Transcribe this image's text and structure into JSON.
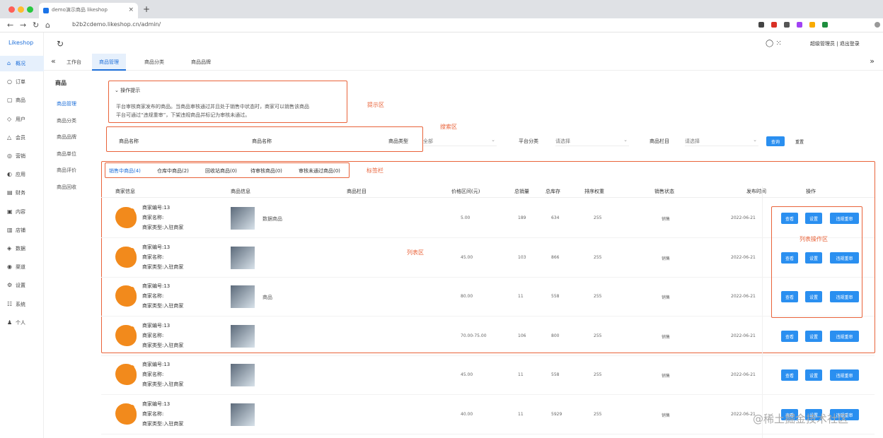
{
  "browser": {
    "tab_title": "demo演示商品 likeshop",
    "tab_close": "×",
    "new_tab": "+",
    "url": "b2b2cdemo.likeshop.cn/admin/",
    "nav": [
      "←",
      "→",
      "↻",
      "⌂"
    ]
  },
  "app": {
    "logo": "Likeshop",
    "refresh": "↻",
    "top_icons": "◯ ⁙",
    "user": "超级管理员 | 退出登录"
  },
  "sidebar": {
    "items": [
      {
        "icon": "⌂",
        "label": "概况",
        "active": true
      },
      {
        "icon": "○",
        "label": "订单"
      },
      {
        "icon": "▢",
        "label": "商品"
      },
      {
        "icon": "◇",
        "label": "用户"
      },
      {
        "icon": "△",
        "label": "会员"
      },
      {
        "icon": "◎",
        "label": "营销"
      },
      {
        "icon": "◐",
        "label": "应用"
      },
      {
        "icon": "▤",
        "label": "财务"
      },
      {
        "icon": "▣",
        "label": "内容"
      },
      {
        "icon": "▥",
        "label": "店铺"
      },
      {
        "icon": "◈",
        "label": "数据"
      },
      {
        "icon": "◉",
        "label": "渠道"
      },
      {
        "icon": "⚙",
        "label": "设置"
      },
      {
        "icon": "☷",
        "label": "系统"
      },
      {
        "icon": "♟",
        "label": "个人"
      }
    ]
  },
  "submenu": {
    "title": "商品",
    "items": [
      {
        "label": "商品管理",
        "active": true
      },
      {
        "label": "商品分类"
      },
      {
        "label": "商品品牌"
      },
      {
        "label": "商品单位"
      },
      {
        "label": "商品评价"
      },
      {
        "label": "商品回收"
      }
    ]
  },
  "page_tabs": {
    "collapse": "«",
    "expand": "»",
    "items": [
      {
        "label": "工作台"
      },
      {
        "label": "商品管理",
        "active": true
      },
      {
        "label": "商品分类"
      },
      {
        "label": "商品品牌"
      }
    ]
  },
  "tip": {
    "title": "操作提示",
    "lines": [
      "平台审核商家发布的商品。当商品审核通过并且处于销售中状态时，商家可以销售该商品",
      "平台可通过“违规重审”，下架违规商品并标记为审核未通过。"
    ],
    "annotation": "提示区"
  },
  "filter": {
    "annotation": "搜索区",
    "fields": [
      {
        "label": "商品名称"
      },
      {
        "label": "商品名称"
      },
      {
        "label": "商品类型",
        "value": "全部"
      },
      {
        "label": "平台分类",
        "value": "请选择"
      },
      {
        "label": "商品栏目",
        "value": "请选择"
      }
    ],
    "query_button": "查询",
    "reset_button": "重置",
    "dropdown_arrow": "⌄"
  },
  "status_tabs": {
    "annotation": "标签栏",
    "items": [
      "销售中商品(4)",
      "仓库中商品(2)",
      "回收站商品(0)",
      "待审核商品(0)",
      "审核未通过商品(0)"
    ]
  },
  "table": {
    "headers": [
      "商家信息",
      "商品信息",
      "商品栏目",
      "价格区间(元)",
      "总销量",
      "总库存",
      "排序权重",
      "销售状态",
      "发布时间",
      "操作"
    ],
    "shop_labels": [
      "商家编号:13",
      "商家名称:",
      "商家类型:入驻商家"
    ],
    "list_annotation": "列表区",
    "actions_annotation": "列表操作区",
    "actions": [
      "查看",
      "设置",
      "违规重审"
    ],
    "rows": [
      {
        "name": "数据商品",
        "price": "5.00",
        "sales": "189",
        "stock": "634",
        "weight": "255",
        "status": "销售",
        "time": "2022-06-21"
      },
      {
        "name": "",
        "price": "45.00",
        "sales": "103",
        "stock": "866",
        "weight": "255",
        "status": "销售",
        "time": "2022-06-21"
      },
      {
        "name": "商品",
        "price": "80.00",
        "sales": "11",
        "stock": "558",
        "weight": "255",
        "status": "销售",
        "time": "2022-06-21"
      },
      {
        "name": "",
        "price": "70.00-75.00",
        "sales": "106",
        "stock": "800",
        "weight": "255",
        "status": "销售",
        "time": "2022-06-21"
      },
      {
        "name": "",
        "price": "45.00",
        "sales": "11",
        "stock": "558",
        "weight": "255",
        "status": "销售",
        "time": "2022-06-21"
      },
      {
        "name": "",
        "price": "40.00",
        "sales": "11",
        "stock": "5929",
        "weight": "255",
        "status": "销售",
        "time": "2022-06-21"
      }
    ]
  },
  "watermark": "@稀土掘金技术社区",
  "colors": {
    "primary": "#2a8ff0",
    "annotation": "#e9633a",
    "pig": "#f28a1c"
  }
}
